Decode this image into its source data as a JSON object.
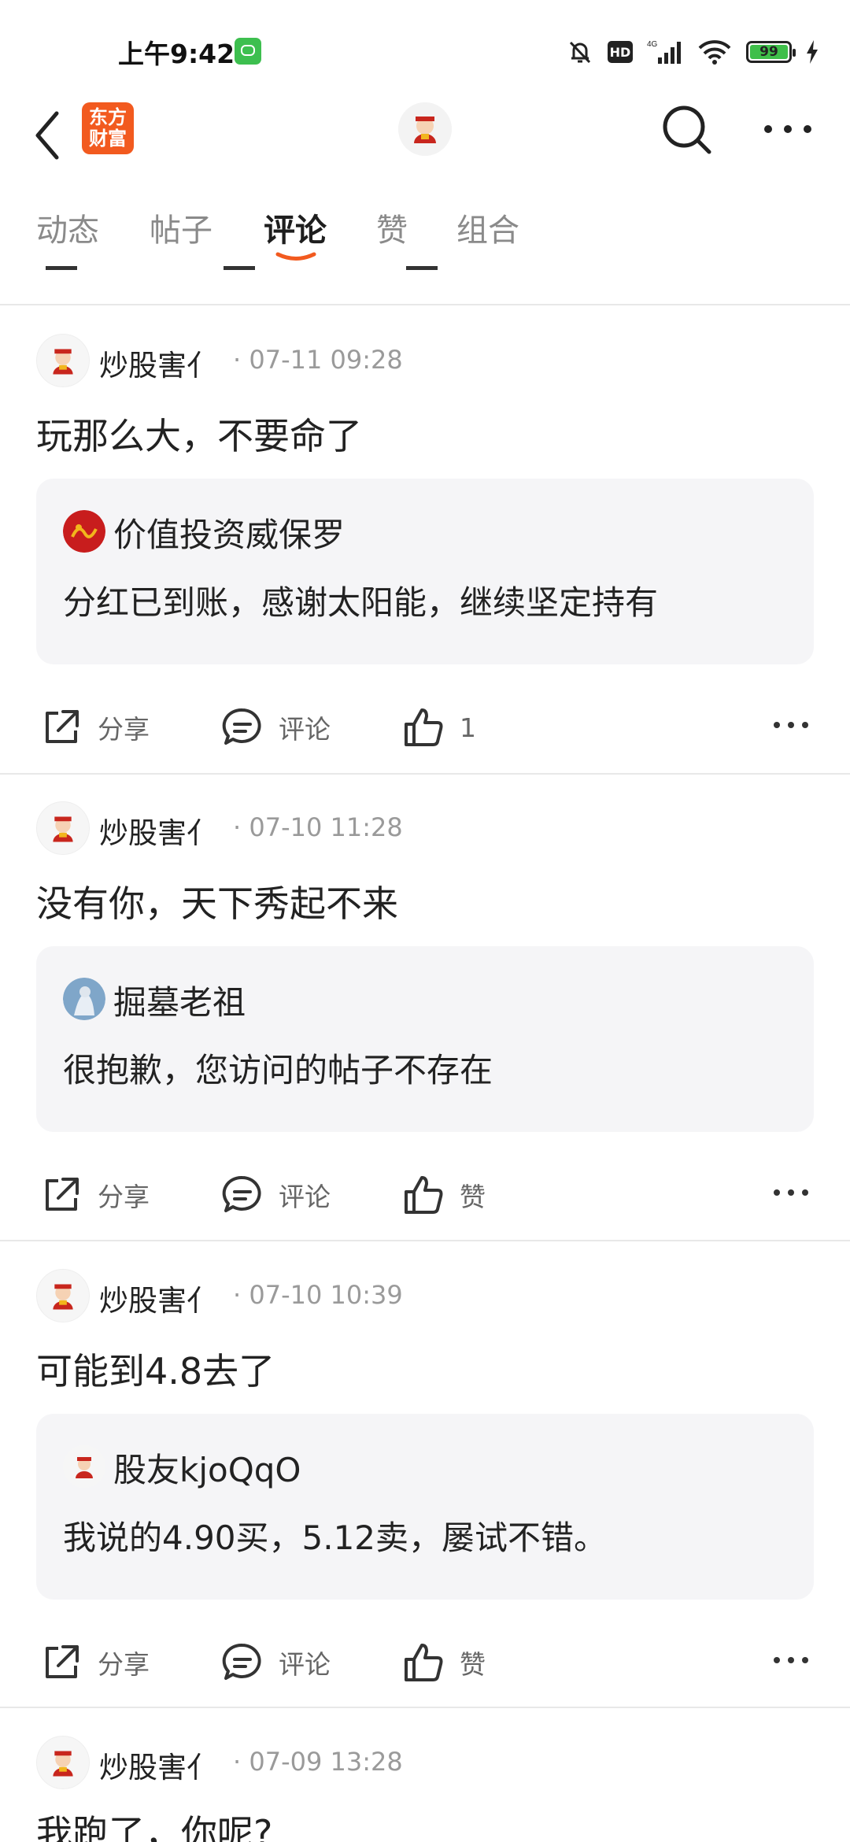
{
  "status_bar": {
    "time": "上午9:42",
    "hd": "HD",
    "network": "4G",
    "battery": "99"
  },
  "header": {
    "logo_line1": "东方",
    "logo_line2": "财富"
  },
  "tabs": [
    {
      "label": "动态"
    },
    {
      "label": "帖子"
    },
    {
      "label": "评论"
    },
    {
      "label": "赞"
    },
    {
      "label": "组合"
    }
  ],
  "active_tab": "评论",
  "accent_color": "#f25a1f",
  "posts": [
    {
      "author": "炒股害亻",
      "time": "· 07-11 09:28",
      "content": "玩那么大，不要命了",
      "quote": {
        "author": "价值投资威保罗",
        "text": "分红已到账，感谢太阳能，继续坚定持有"
      },
      "share": "分享",
      "comment": "评论",
      "like": "1"
    },
    {
      "author": "炒股害亻",
      "time": "· 07-10 11:28",
      "content": "没有你，天下秀起不来",
      "quote": {
        "author": "掘墓老祖",
        "text": "很抱歉，您访问的帖子不存在"
      },
      "share": "分享",
      "comment": "评论",
      "like": "赞"
    },
    {
      "author": "炒股害亻",
      "time": "· 07-10 10:39",
      "content": "可能到4.8去了",
      "quote": {
        "author": "股友kjoQqO",
        "text": "我说的4.90买，5.12卖，屡试不错。"
      },
      "share": "分享",
      "comment": "评论",
      "like": "赞"
    },
    {
      "author": "炒股害亻",
      "time": "· 07-09 13:28",
      "content": "我跑了，你呢?"
    }
  ]
}
